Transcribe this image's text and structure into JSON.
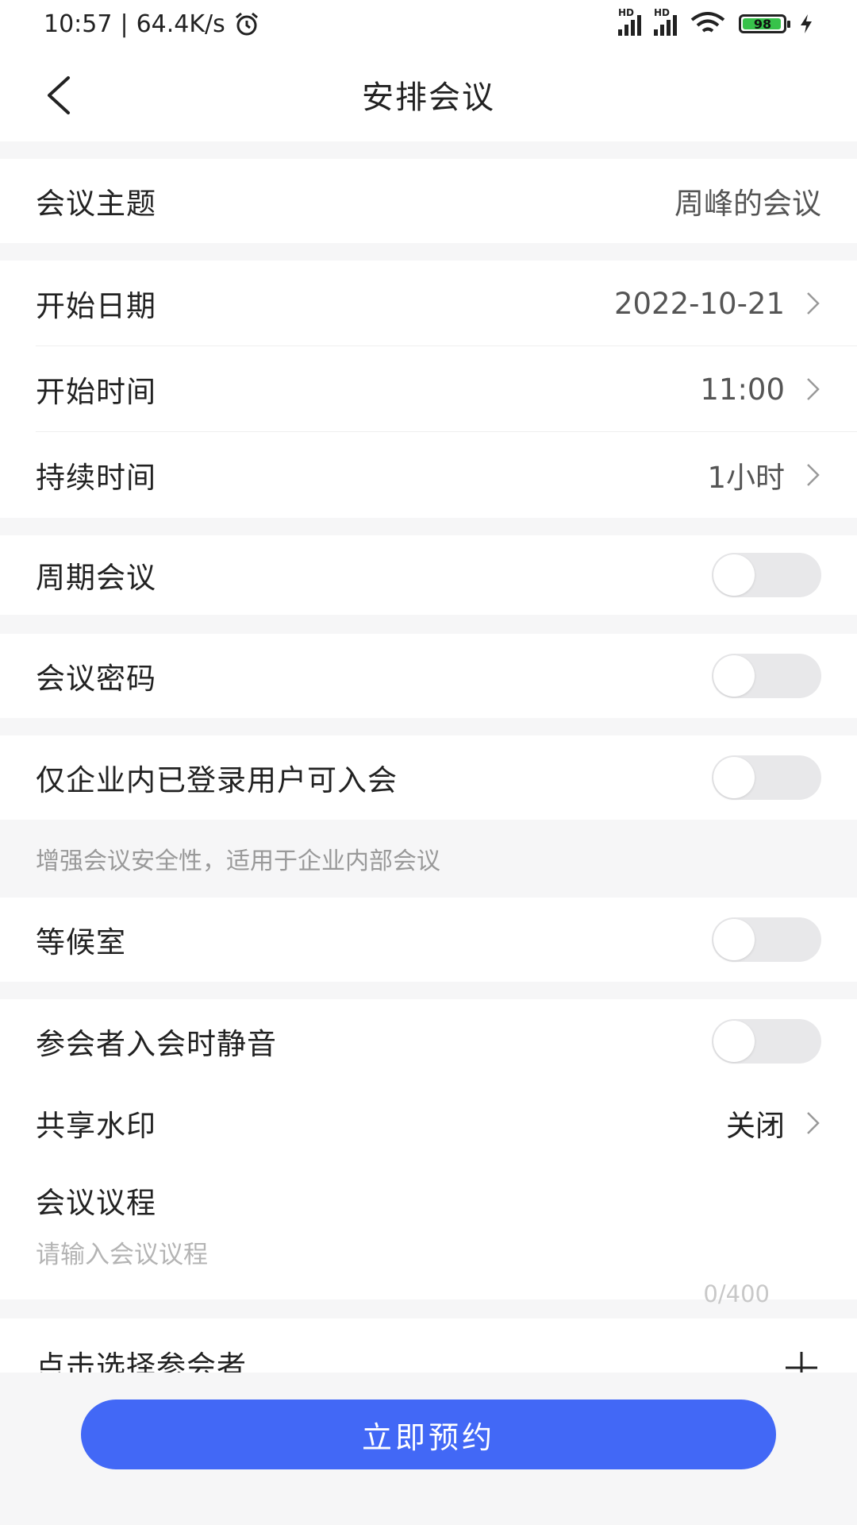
{
  "status_bar": {
    "time": "10:57",
    "speed": "64.4K/s",
    "signal_label": "HD",
    "battery": "98"
  },
  "header": {
    "title": "安排会议"
  },
  "topic": {
    "label": "会议主题",
    "value": "周峰的会议"
  },
  "schedule": {
    "start_date": {
      "label": "开始日期",
      "value": "2022-10-21"
    },
    "start_time": {
      "label": "开始时间",
      "value": "11:00"
    },
    "duration": {
      "label": "持续时间",
      "value": "1小时"
    }
  },
  "recurring": {
    "label": "周期会议",
    "enabled": false
  },
  "password": {
    "label": "会议密码",
    "enabled": false
  },
  "internal_only": {
    "label": "仅企业内已登录用户可入会",
    "hint": "增强会议安全性，适用于企业内部会议",
    "enabled": false
  },
  "waiting_room": {
    "label": "等候室",
    "enabled": false
  },
  "mute_on_join": {
    "label": "参会者入会时静音",
    "enabled": false
  },
  "watermark": {
    "label": "共享水印",
    "value": "关闭"
  },
  "agenda": {
    "label": "会议议程",
    "placeholder": "请输入会议议程",
    "value": "",
    "count": "0/400"
  },
  "participants": {
    "label": "点击选择参会者"
  },
  "submit": {
    "label": "立即预约"
  },
  "colors": {
    "accent": "#4268f6",
    "toggle_off": "#e8e8ea",
    "background": "#f6f6f7"
  }
}
